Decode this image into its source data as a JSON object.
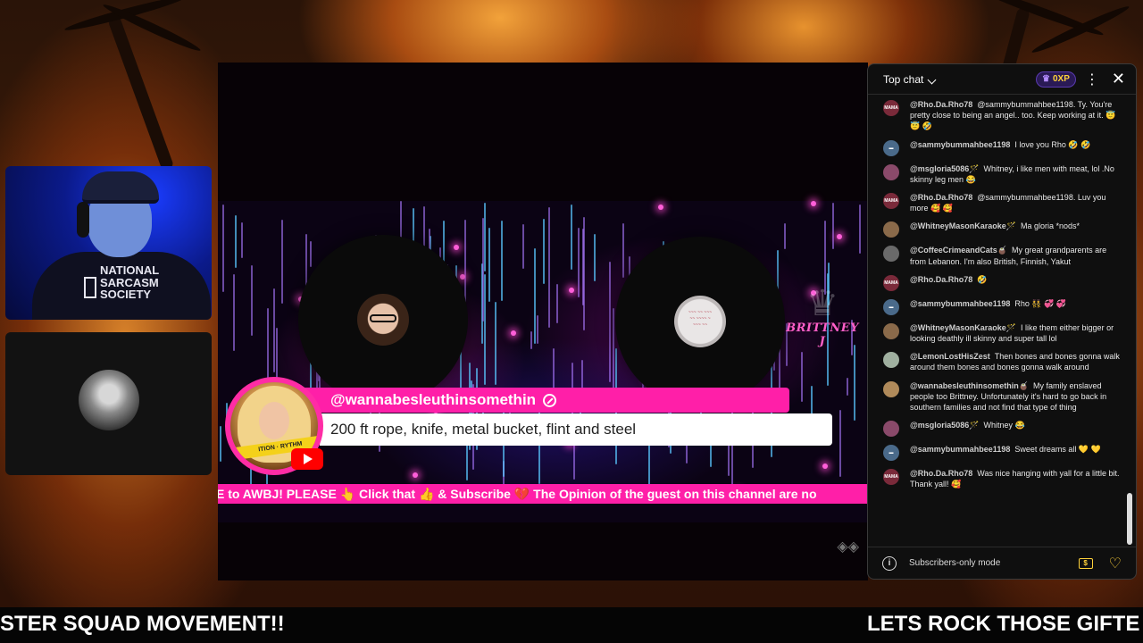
{
  "stream": {
    "comment": {
      "username": "@wannabesleuthinsomethin",
      "text": "200 ft rope, knife, metal bucket, flint and steel",
      "avatar_tape_text": "ITION · RYTHM"
    },
    "ticker_text": "E to AWBJ! PLEASE 👆 Click that 👍 & Subscribe 💔 The Opinion of the guest on this channel are no",
    "logo_text": "BRITTNEY J",
    "shirt_text": "NATIONAL SARCASM SOCIETY",
    "bottom_left_text": "STER SQUAD MOVEMENT!!",
    "bottom_right_text": "LETS ROCK THOSE GIFTE"
  },
  "chat": {
    "title": "Top chat",
    "xp_badge": "0XP",
    "messages": [
      {
        "author": "@Rho.Da.Rho78",
        "text": "@sammybummahbee1198. Ty. You're pretty close to being an angel.. too. Keep working at it. 😇 😇 🤣",
        "avatar_color": "#7a2a3a",
        "avatar_label": "MAMA"
      },
      {
        "author": "@sammybummahbee1198",
        "text": "I love you Rho 🤣 🤣",
        "avatar_color": "#4a6a8a",
        "avatar_label": "▬"
      },
      {
        "author": "@msgloria5086🪄",
        "text": "Whitney, i like men with meat, lol .No skinny leg men 😂",
        "avatar_color": "#8a4a6a",
        "avatar_label": ""
      },
      {
        "author": "@Rho.Da.Rho78",
        "text": "@sammybummahbee1198. Luv you more 🥰 🥰",
        "avatar_color": "#7a2a3a",
        "avatar_label": "MAMA"
      },
      {
        "author": "@WhitneyMasonKaraoke🪄",
        "text": "Ma gloria *nods*",
        "avatar_color": "#8a6a4a",
        "avatar_label": ""
      },
      {
        "author": "@CoffeeCrimeandCats🧉",
        "text": "My great grandparents are from Lebanon. I'm also British, Finnish, Yakut",
        "avatar_color": "#6a6a6a",
        "avatar_label": ""
      },
      {
        "author": "@Rho.Da.Rho78",
        "text": "🤣",
        "avatar_color": "#7a2a3a",
        "avatar_label": "MAMA"
      },
      {
        "author": "@sammybummahbee1198",
        "text": "Rho 👯 💞 💞",
        "avatar_color": "#4a6a8a",
        "avatar_label": "▬"
      },
      {
        "author": "@WhitneyMasonKaraoke🪄",
        "text": "I like them either bigger or looking deathly ill skinny and super tall lol",
        "avatar_color": "#8a6a4a",
        "avatar_label": ""
      },
      {
        "author": "@LemonLostHisZest",
        "text": "Then bones and bones gonna walk around them bones and bones gonna walk around",
        "avatar_color": "#a0b0a0",
        "avatar_label": ""
      },
      {
        "author": "@wannabesleuthinsomethin🧉",
        "text": "My family enslaved people too Brittney. Unfortunately it's hard to go back in southern families and not find that type of thing",
        "avatar_color": "#b08a5a",
        "avatar_label": ""
      },
      {
        "author": "@msgloria5086🪄",
        "text": "Whitney 😂",
        "avatar_color": "#8a4a6a",
        "avatar_label": ""
      },
      {
        "author": "@sammybummahbee1198",
        "text": "Sweet dreams all 💛 💛",
        "avatar_color": "#4a6a8a",
        "avatar_label": "▬"
      },
      {
        "author": "@Rho.Da.Rho78",
        "text": "Was nice hanging with yall for a little bit. Thank yall! 🥰",
        "avatar_color": "#7a2a3a",
        "avatar_label": "MAMA"
      }
    ],
    "footer_text": "Subscribers-only mode"
  }
}
